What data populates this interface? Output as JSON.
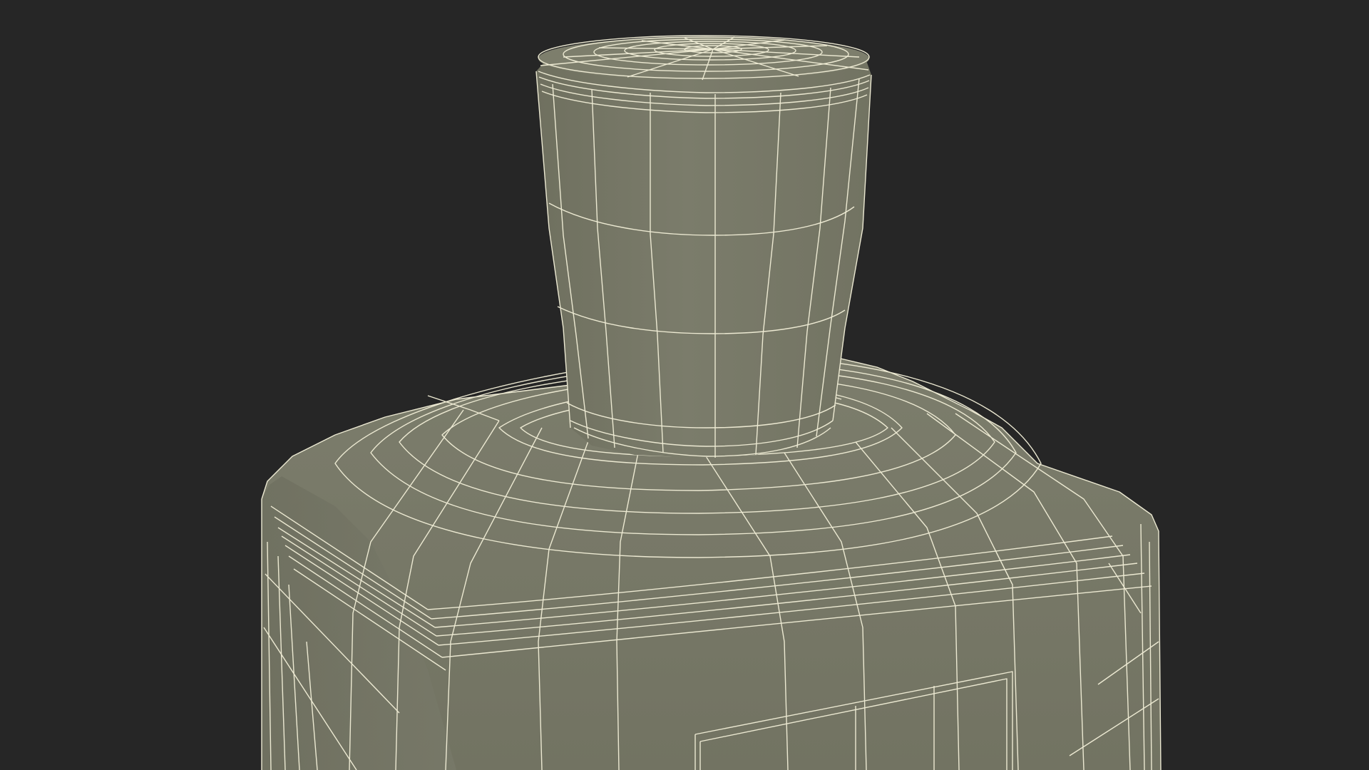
{
  "scene": {
    "subject": "wireframe-perfume-bottle",
    "colors": {
      "background": "#262626",
      "surface": "#7a7b69",
      "surface_shadow": "#6c6d5c",
      "surface_light": "#85867a",
      "wire": "#ece9d2"
    }
  }
}
